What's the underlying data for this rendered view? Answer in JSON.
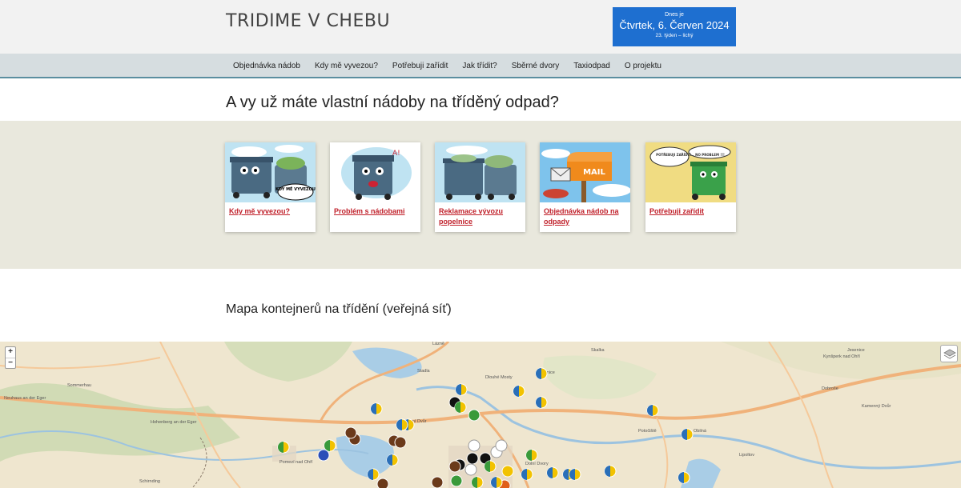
{
  "header": {
    "logo_text": "TRIDIME V CHEBU",
    "date": {
      "line1": "Dnes je",
      "line2": "Čtvrtek, 6. Červen 2024",
      "line3": "23. týden – lichý"
    }
  },
  "nav": {
    "items": [
      "Objednávka nádob",
      "Kdy mě vyvezou?",
      "Potřebuji zařídit",
      "Jak třídit?",
      "Sběrné dvory",
      "Taxiodpad",
      "O projektu"
    ]
  },
  "main": {
    "title": "A vy už máte vlastní nádoby na tříděný odpad?",
    "cards": [
      {
        "label": "Kdy mě vyvezou?",
        "image_text": "KDY MĚ VYVEZOU"
      },
      {
        "label": "Problém s nádobami",
        "image_text": "A!"
      },
      {
        "label": "Reklamace vývozu popelnice",
        "image_text": ""
      },
      {
        "label": "Objednávka nádob na odpady",
        "image_text": "MAIL"
      },
      {
        "label": "Potřebuji zařídit",
        "image_text": "POTŘEBUJI ZAŘÍDIT... NO PROBLEM !!!"
      }
    ]
  },
  "map_section": {
    "title": "Mapa kontejnerů na třídění (veřejná síť)",
    "zoom_in": "+",
    "zoom_out": "−",
    "labels": [
      "Lázně",
      "Stadla",
      "Dlouhé Mosty",
      "Hohenberg an der Eger",
      "Neuhaus an der Eger",
      "Sommerhau",
      "Potočiště",
      "Obilná",
      "Lipoltov",
      "Kamenný Dvůr",
      "Dobroše",
      "Kynšperk nad Ohří",
      "Pomezí nad Ohří",
      "Schirnding",
      "Dolní Dvory",
      "Tršnice",
      "Jesenice",
      "Skalka",
      "Horní Dvůr"
    ]
  }
}
